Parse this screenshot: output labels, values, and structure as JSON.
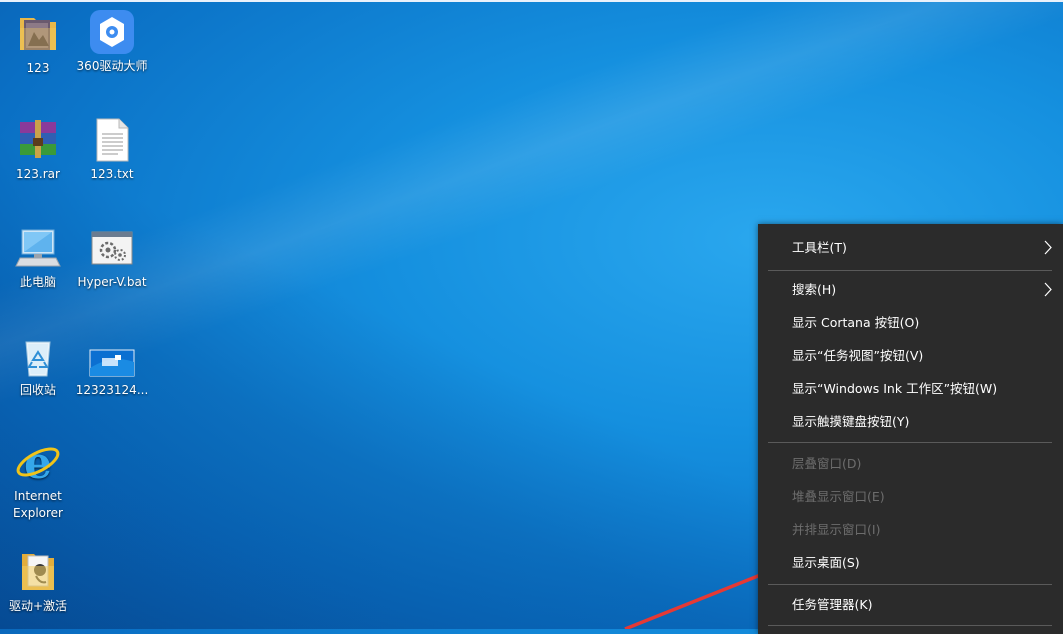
{
  "desktop_icons": [
    {
      "label": "123",
      "icon": "folder-icon"
    },
    {
      "label": "360驱动大师",
      "icon": "360-driver-icon"
    },
    {
      "label": "123.rar",
      "icon": "winrar-icon"
    },
    {
      "label": "123.txt",
      "icon": "text-file-icon"
    },
    {
      "label": "此电脑",
      "icon": "computer-icon"
    },
    {
      "label": "Hyper-V.bat",
      "icon": "batch-file-icon"
    },
    {
      "label": "回收站",
      "icon": "recycle-bin-icon"
    },
    {
      "label": "12323124...",
      "icon": "image-file-icon"
    },
    {
      "label_line1": "Internet",
      "label_line2": "Explorer",
      "icon": "internet-explorer-icon"
    },
    {
      "label": "驱动+激活",
      "icon": "folder-icon"
    }
  ],
  "context_menu": {
    "items": [
      {
        "label": "工具栏(T)",
        "submenu": true,
        "enabled": true
      },
      {
        "label": "搜索(H)",
        "submenu": true,
        "enabled": true
      },
      {
        "label": "显示 Cortana 按钮(O)",
        "enabled": true
      },
      {
        "label": "显示“任务视图”按钮(V)",
        "enabled": true
      },
      {
        "label": "显示“Windows Ink 工作区”按钮(W)",
        "enabled": true
      },
      {
        "label": "显示触摸键盘按钮(Y)",
        "enabled": true
      },
      {
        "label": "层叠窗口(D)",
        "enabled": false
      },
      {
        "label": "堆叠显示窗口(E)",
        "enabled": false
      },
      {
        "label": "并排显示窗口(I)",
        "enabled": false
      },
      {
        "label": "显示桌面(S)",
        "enabled": true,
        "highlighted_by_arrow": true
      },
      {
        "label": "任务管理器(K)",
        "enabled": true
      }
    ]
  },
  "colors": {
    "menu_bg": "#2b2b2b",
    "menu_text": "#ffffff",
    "menu_disabled_text": "#6d6d6d",
    "annotation_arrow": "#e53935"
  }
}
